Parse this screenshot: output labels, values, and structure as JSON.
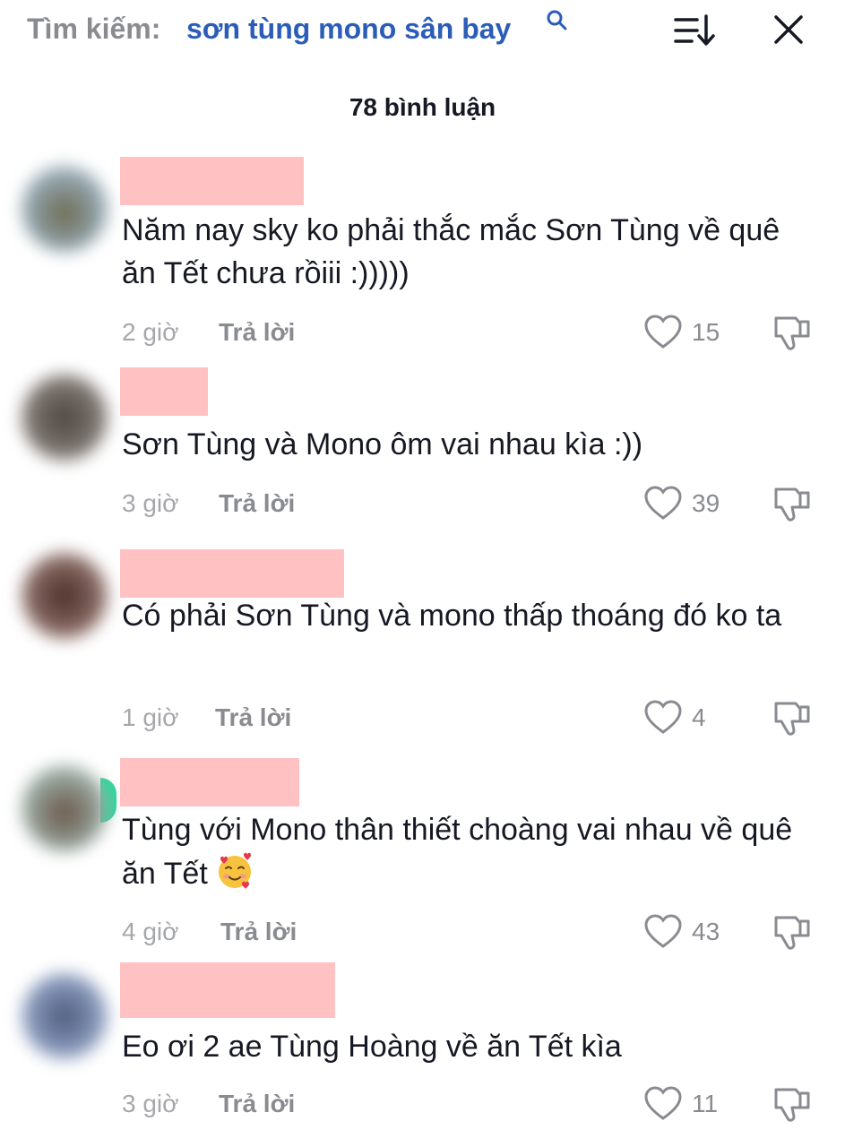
{
  "header": {
    "search_prefix": "Tìm kiếm:",
    "search_query": "sơn tùng mono sân bay"
  },
  "comment_count": "78 bình luận",
  "reply_label": "Trả lời",
  "comments": [
    {
      "text": "Năm nay sky ko phải thắc mắc Sơn Tùng về quê ăn Tết chưa rồiii :)))))",
      "time": "2 giờ",
      "likes": "15"
    },
    {
      "text": "Sơn Tùng và Mono ôm vai nhau kìa :))",
      "time": "3 giờ",
      "likes": "39"
    },
    {
      "text": "Có phải Sơn Tùng và mono thấp thoáng đó ko ta",
      "time": "1 giờ",
      "likes": "4"
    },
    {
      "text": "Tùng với Mono thân thiết choàng vai nhau về quê ăn Tết",
      "time": "4 giờ",
      "likes": "43",
      "emoji": "smiling-face-with-hearts-icon"
    },
    {
      "text": "Eo ơi 2 ae Tùng Hoàng về ăn Tết kìa",
      "time": "3 giờ",
      "likes": "11"
    }
  ],
  "colors": {
    "query_link": "#2b5db8",
    "muted_text": "#8a8b91",
    "name_redaction": "#ffc1c1",
    "primary_text": "#161823"
  }
}
